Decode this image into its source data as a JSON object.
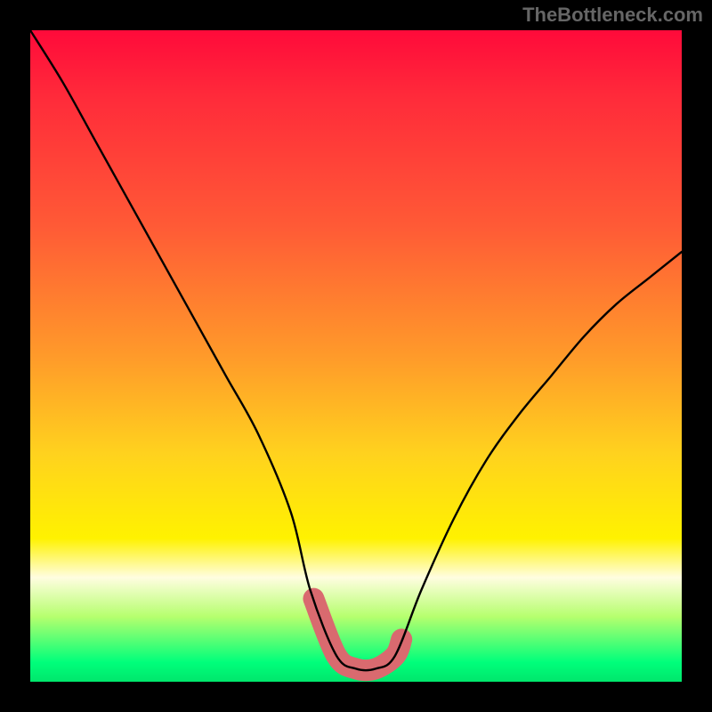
{
  "watermark": "TheBottleneck.com",
  "chart_data": {
    "type": "line",
    "title": "",
    "xlabel": "",
    "ylabel": "",
    "xlim": [
      0,
      100
    ],
    "ylim": [
      0,
      100
    ],
    "grid": false,
    "legend": false,
    "series": [
      {
        "name": "bottleneck-curve",
        "x": [
          0,
          5,
          10,
          15,
          20,
          25,
          30,
          35,
          40,
          43,
          47,
          50,
          53,
          56,
          60,
          65,
          70,
          75,
          80,
          85,
          90,
          95,
          100
        ],
        "y": [
          100,
          92,
          83,
          74,
          65,
          56,
          47,
          38,
          26,
          14,
          4,
          2,
          2,
          4,
          14,
          25,
          34,
          41,
          47,
          53,
          58,
          62,
          66
        ]
      }
    ],
    "annotations": [
      {
        "name": "trough-highlight",
        "x_range": [
          43.5,
          57
        ],
        "y_approx": 3,
        "color": "#d96a6f",
        "thickness_px": 24
      }
    ],
    "gradient_stops": [
      {
        "pos": 0.0,
        "color": "#ff0a3a"
      },
      {
        "pos": 0.1,
        "color": "#ff2a3a"
      },
      {
        "pos": 0.3,
        "color": "#ff5a36"
      },
      {
        "pos": 0.5,
        "color": "#ff9a2a"
      },
      {
        "pos": 0.65,
        "color": "#ffd21e"
      },
      {
        "pos": 0.78,
        "color": "#fff200"
      },
      {
        "pos": 0.84,
        "color": "#fffde0"
      },
      {
        "pos": 0.9,
        "color": "#b6ff6e"
      },
      {
        "pos": 0.97,
        "color": "#00ff7b"
      },
      {
        "pos": 1.0,
        "color": "#00e66c"
      }
    ]
  }
}
